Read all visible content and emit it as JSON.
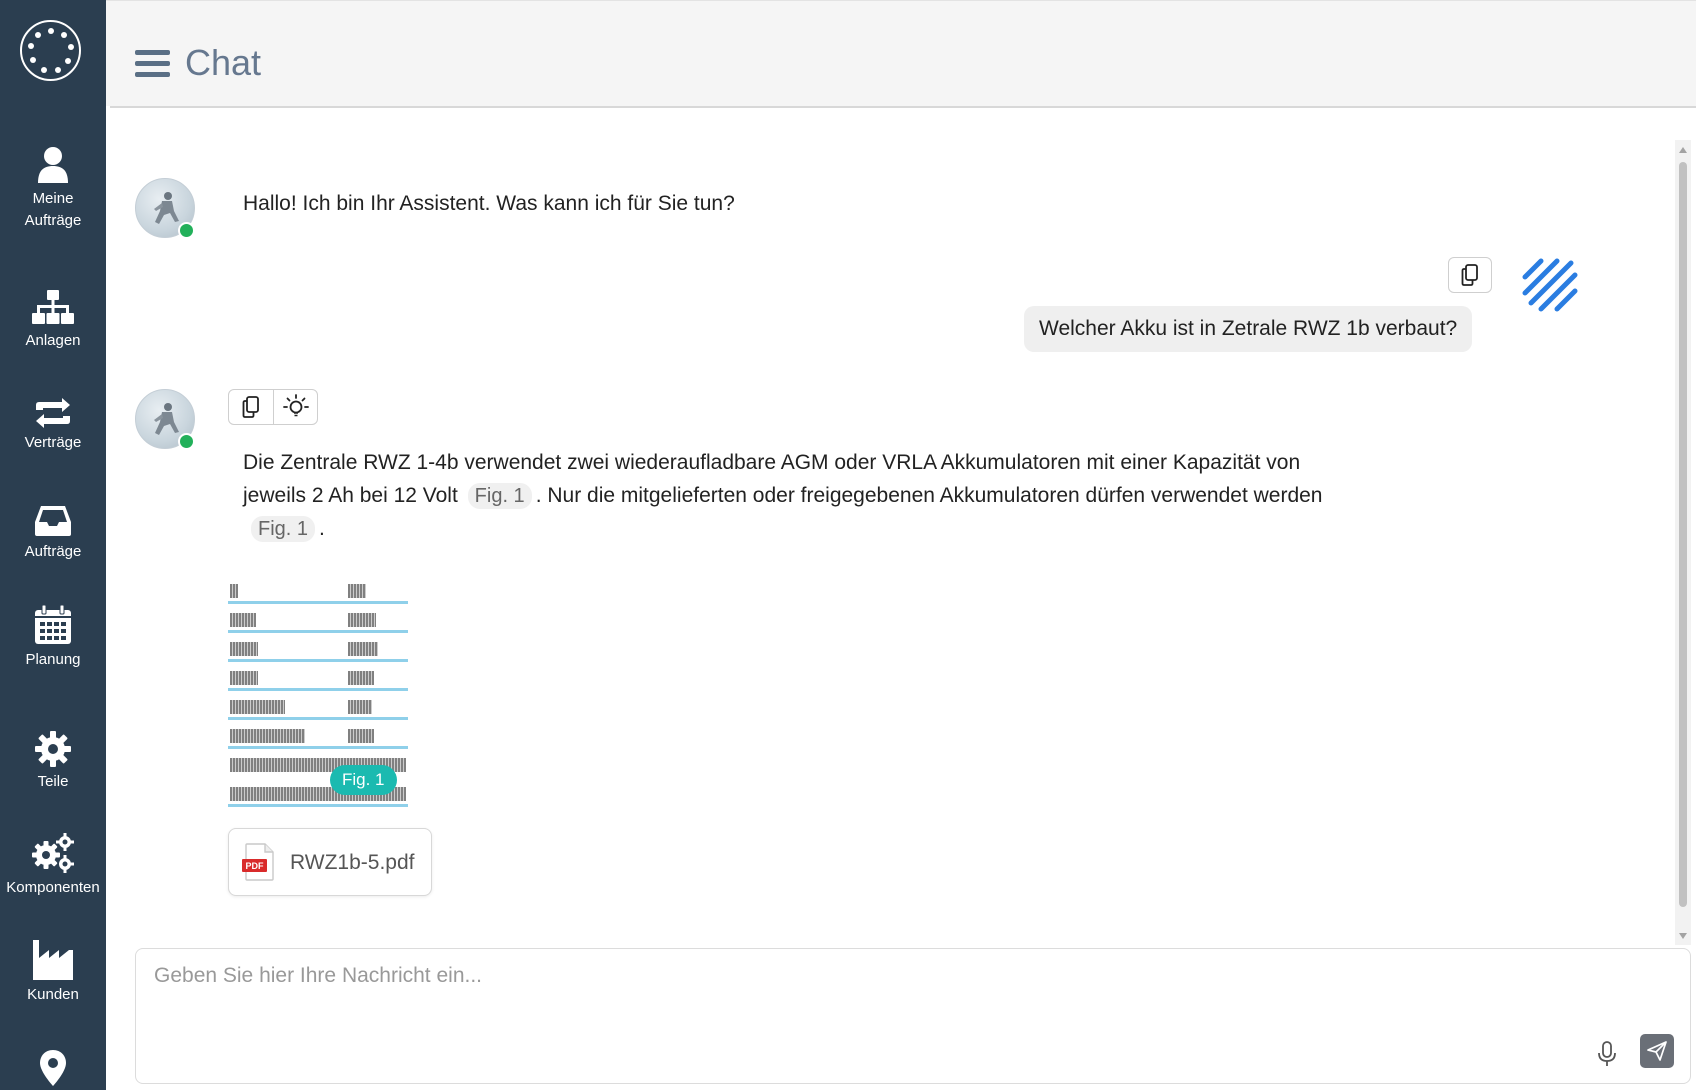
{
  "app": {
    "title": "Chat"
  },
  "sidebar": {
    "items": [
      {
        "label_line1": "Meine",
        "label_line2": "Aufträge",
        "icon": "user-icon"
      },
      {
        "label": "Anlagen",
        "icon": "sitemap-icon"
      },
      {
        "label": "Verträge",
        "icon": "retweet-icon"
      },
      {
        "label": "Aufträge",
        "icon": "inbox-icon"
      },
      {
        "label": "Planung",
        "icon": "calendar-icon"
      },
      {
        "label": "Teile",
        "icon": "gear-icon"
      },
      {
        "label": "Komponenten",
        "icon": "gears-icon"
      },
      {
        "label": "Kunden",
        "icon": "factory-icon"
      },
      {
        "label": "",
        "icon": "map-marker-icon"
      }
    ]
  },
  "messages": {
    "greeting": "Hallo! Ich bin Ihr Assistent. Was kann ich für Sie tun?",
    "user_question": "Welcher Akku ist in Zetrale RWZ 1b verbaut?",
    "answer": {
      "line1": "Die Zentrale RWZ 1-4b verwendet zwei wiederaufladbare AGM oder VRLA Akkumulatoren mit einer Kapazität von",
      "line2_a": "jeweils 2 Ah bei 12 Volt",
      "fig_ref_1": "Fig. 1",
      "line2_b": ". Nur die mitgelieferten oder freigegebenen Akkumulatoren dürfen verwendet werden",
      "fig_ref_2": "Fig. 1",
      "line3_end": "."
    },
    "figure_badge": "Fig. 1",
    "attachment": {
      "filename": "RWZ1b-5.pdf",
      "icon_text": "PDF"
    }
  },
  "input": {
    "placeholder": "Geben Sie hier Ihre Nachricht ein..."
  },
  "colors": {
    "sidebar_bg": "#2b3e50",
    "online": "#22b05a",
    "fig_badge": "#1bbab0",
    "user_logo": "#2a7de1",
    "pdf_red": "#d92b2b"
  }
}
